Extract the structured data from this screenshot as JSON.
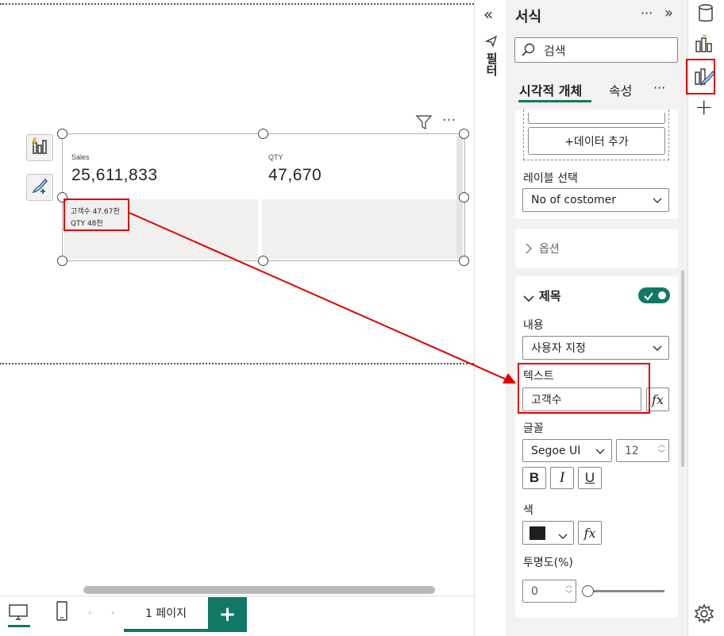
{
  "canvas": {
    "visual": {
      "cards": [
        {
          "title": "Sales",
          "value": "25,611,833"
        },
        {
          "title": "QTY",
          "value": "47,670"
        }
      ],
      "tooltip_lines": [
        "고객수 47.67천",
        "QTY 48천"
      ]
    }
  },
  "pages": {
    "tab_label": "1 페이지",
    "add_label": "+"
  },
  "filters_strip": {
    "label": "필터"
  },
  "format_pane": {
    "title": "서식",
    "search_placeholder": "검색",
    "tabs": [
      "시각적 개체",
      "속성"
    ],
    "more": "···",
    "add_data_label": "+데이터 추가",
    "label_select": {
      "label": "레이블 선택",
      "value": "No of costomer"
    },
    "options_section": {
      "label": "옵션"
    },
    "title_section": {
      "label": "제목",
      "toggle_on": true,
      "content_label": "내용",
      "content_value": "사용자 지정",
      "text_label": "텍스트",
      "text_value": "고객수",
      "font_label": "글꼴",
      "font_family": "Segoe UI",
      "font_size": "12",
      "bold": "B",
      "italic": "I",
      "underline": "U",
      "color_label": "색",
      "color_value": "#1f1f1f",
      "transparency_label": "투명도(%)",
      "transparency_value": "0",
      "fx_label": "fx"
    }
  },
  "colors": {
    "accent": "#117865",
    "highlight": "#e00000"
  }
}
